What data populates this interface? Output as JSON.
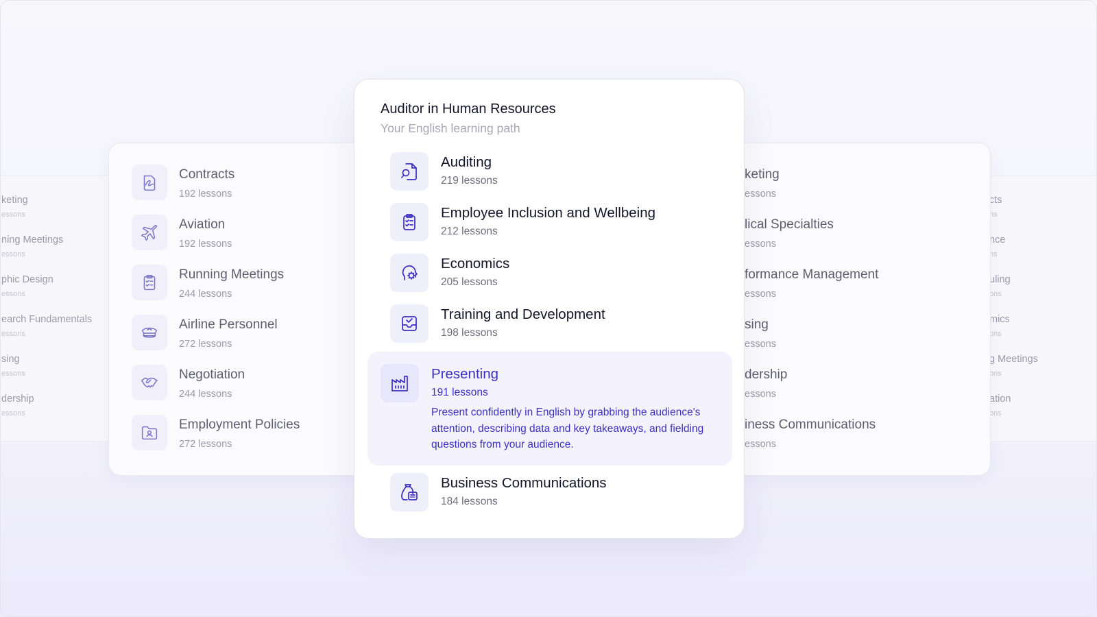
{
  "background_left": [
    {
      "title": "keting",
      "sub": "essons"
    },
    {
      "title": "ning Meetings",
      "sub": "essons"
    },
    {
      "title": "phic Design",
      "sub": "essons"
    },
    {
      "title": "earch Fundamentals",
      "sub": "essons"
    },
    {
      "title": "sing",
      "sub": "essons"
    },
    {
      "title": "dership",
      "sub": "essons"
    }
  ],
  "background_right": [
    {
      "title": "cts",
      "sub": "ns"
    },
    {
      "title": "nce",
      "sub": "ns"
    },
    {
      "title": "uling",
      "sub": "ons"
    },
    {
      "title": "mics",
      "sub": "ons"
    },
    {
      "title": "g Meetings",
      "sub": "ons"
    },
    {
      "title": "ation",
      "sub": "ons"
    }
  ],
  "left_card": [
    {
      "title": "Contracts",
      "lessons": "192 lessons",
      "icon": "contract-icon"
    },
    {
      "title": "Aviation",
      "lessons": "192 lessons",
      "icon": "airplane-icon"
    },
    {
      "title": "Running Meetings",
      "lessons": "244 lessons",
      "icon": "clipboard-list-icon"
    },
    {
      "title": "Airline Personnel",
      "lessons": "272 lessons",
      "icon": "pilot-cap-icon"
    },
    {
      "title": "Negotiation",
      "lessons": "244 lessons",
      "icon": "handshake-icon"
    },
    {
      "title": "Employment Policies",
      "lessons": "272 lessons",
      "icon": "folder-user-icon"
    }
  ],
  "right_card": [
    {
      "title": "keting",
      "lessons": "essons"
    },
    {
      "title": "lical Specialties",
      "lessons": "essons"
    },
    {
      "title": "formance Management",
      "lessons": "essons"
    },
    {
      "title": "sing",
      "lessons": "essons"
    },
    {
      "title": "dership",
      "lessons": "essons"
    },
    {
      "title": "iness Communications",
      "lessons": "essons"
    }
  ],
  "main": {
    "title": "Auditor in Human Resources",
    "subtitle": "Your English learning path",
    "items": [
      {
        "title": "Auditing",
        "lessons": "219 lessons",
        "icon": "document-search-icon"
      },
      {
        "title": "Employee Inclusion and Wellbeing",
        "lessons": "212 lessons",
        "icon": "clipboard-check-icon"
      },
      {
        "title": "Economics",
        "lessons": "205 lessons",
        "icon": "head-gear-icon"
      },
      {
        "title": "Training and Development",
        "lessons": "198 lessons",
        "icon": "inbox-check-icon"
      }
    ],
    "active": {
      "title": "Presenting",
      "lessons": "191 lessons",
      "description": "Present confidently in English by grabbing the audience's attention, describing data and key takeaways, and fielding questions from your audience.",
      "icon": "factory-icon"
    },
    "last": {
      "title": "Business Communications",
      "lessons": "184 lessons",
      "icon": "money-bag-calculator-icon"
    }
  },
  "colors": {
    "accent": "#3b2fc2",
    "side_icon": "#7b73c6",
    "active_bg": "#f4f3fd"
  }
}
